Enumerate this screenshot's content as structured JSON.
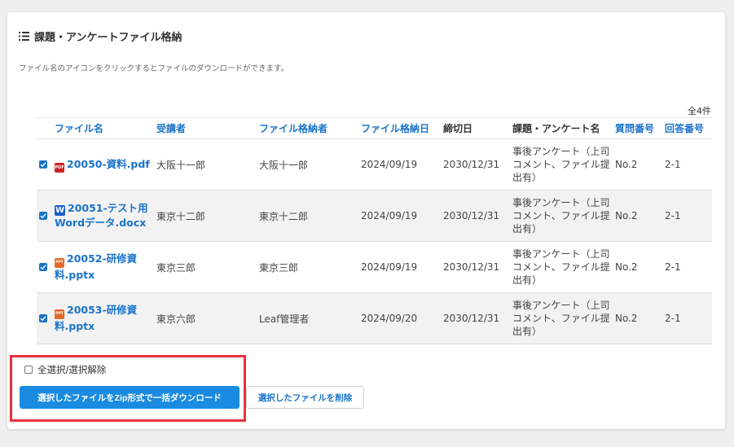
{
  "section": {
    "title": "課題・アンケートファイル格納",
    "instruction": "ファイル名のアイコンをクリックするとファイルのダウンロードができます。",
    "count": "全4件"
  },
  "table": {
    "headers": {
      "file_name": "ファイル名",
      "student": "受講者",
      "owner": "ファイル格納者",
      "stored_date": "ファイル格納日",
      "deadline": "締切日",
      "task_name": "課題・アンケート名",
      "question_no": "質問番号",
      "answer_no": "回答番号"
    },
    "rows": [
      {
        "icon": "pdf-icon",
        "icon_text": "PDF",
        "file_name": "20050-資料.pdf",
        "student": "大阪十一郎",
        "owner": "大阪十一郎",
        "stored_date": "2024/09/19",
        "deadline": "2030/12/31",
        "task_name": "事後アンケート（上司コメント、ファイル提出有）",
        "question_no": "No.2",
        "answer_no": "2-1"
      },
      {
        "icon": "word-icon",
        "icon_text": "W",
        "file_name": "20051-テスト用Wordデータ.docx",
        "student": "東京十二郎",
        "owner": "東京十二郎",
        "stored_date": "2024/09/19",
        "deadline": "2030/12/31",
        "task_name": "事後アンケート（上司コメント、ファイル提出有）",
        "question_no": "No.2",
        "answer_no": "2-1"
      },
      {
        "icon": "powerpoint-icon",
        "icon_text": "PPT",
        "file_name": "20052-研修資料.pptx",
        "student": "東京三郎",
        "owner": "東京三郎",
        "stored_date": "2024/09/19",
        "deadline": "2030/12/31",
        "task_name": "事後アンケート（上司コメント、ファイル提出有）",
        "question_no": "No.2",
        "answer_no": "2-1"
      },
      {
        "icon": "powerpoint-icon",
        "icon_text": "PPT",
        "file_name": "20053-研修資料.pptx",
        "student": "東京六郎",
        "owner": "Leaf管理者",
        "stored_date": "2024/09/20",
        "deadline": "2030/12/31",
        "task_name": "事後アンケート（上司コメント、ファイル提出有）",
        "question_no": "No.2",
        "answer_no": "2-1"
      }
    ]
  },
  "controls": {
    "select_all_label": "全選択/選択解除",
    "download_button": "選択したファイルをZip形式で一括ダウンロード",
    "delete_button": "選択したファイルを削除"
  },
  "colors": {
    "accent": "#1a73c8",
    "primary_button": "#1a8be0",
    "highlight_box": "#e8303a",
    "pdf_icon": "#cc2222",
    "word_icon": "#1a5fc8",
    "ppt_icon": "#e06a2a"
  }
}
